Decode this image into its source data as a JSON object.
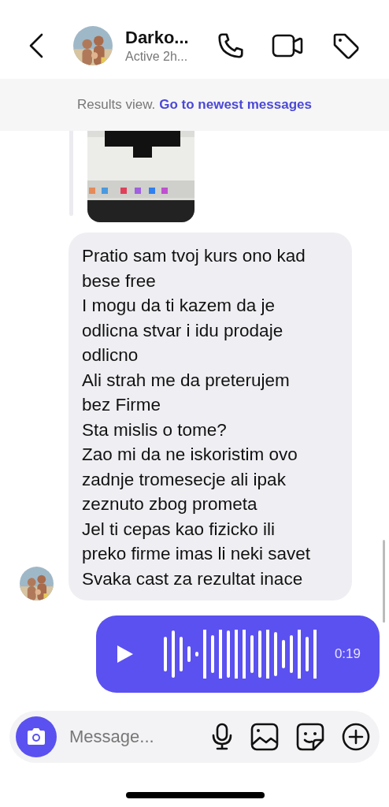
{
  "header": {
    "name": "Darko...",
    "status": "Active 2h..."
  },
  "banner": {
    "text": "Results view.",
    "link": "Go to newest messages"
  },
  "messages": [
    {
      "kind": "story"
    },
    {
      "kind": "text",
      "show_avatar": true,
      "lines": [
        "Pratio sam tvoj kurs ono kad bese free",
        "I mogu da ti kazem da je odlicna stvar i idu prodaje odlicno",
        "Ali strah me da preterujem bez Firme",
        "Sta mislis o tome?",
        "Zao mi da ne iskoristim ovo zadnje tromesecje ali ipak zeznuto zbog prometa",
        "Jel ti cepas kao fizicko ili preko firme imas li neki savet",
        "Svaka cast za rezultat inace"
      ]
    },
    {
      "kind": "voice",
      "duration": "0:19"
    }
  ],
  "composer": {
    "placeholder": "Message..."
  }
}
